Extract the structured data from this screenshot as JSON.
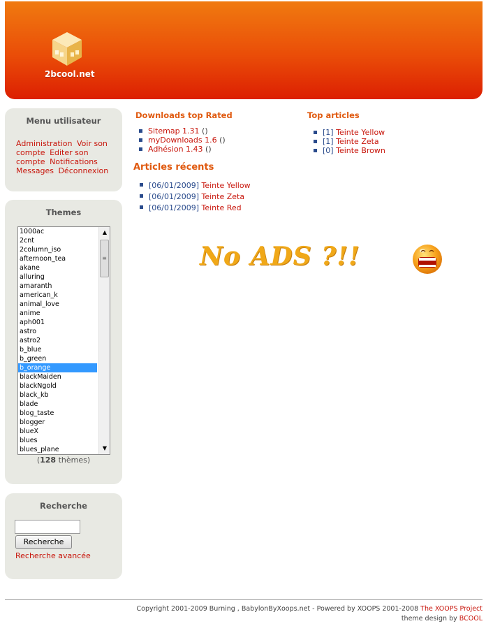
{
  "header": {
    "logo_text": "2bcool.net"
  },
  "user_menu": {
    "title": "Menu utilisateur",
    "links": [
      "Administration",
      "Voir son compte",
      "Editer son compte",
      "Notifications",
      "Messages",
      "Déconnexion"
    ]
  },
  "themes": {
    "title": "Themes",
    "items": [
      "1000ac",
      "2cnt",
      "2column_iso",
      "afternoon_tea",
      "akane",
      "alluring",
      "amaranth",
      "american_k",
      "animal_love",
      "anime",
      "aph001",
      "astro",
      "astro2",
      "b_blue",
      "b_green",
      "b_orange",
      "blackMaiden",
      "blackNgold",
      "black_kb",
      "blade",
      "blog_taste",
      "blogger",
      "blueX",
      "blues",
      "blues_plane"
    ],
    "selected": "b_orange",
    "count_open": "(",
    "count": "128",
    "count_label": "thèmes)"
  },
  "search": {
    "title": "Recherche",
    "input_value": "",
    "button_label": "Recherche",
    "advanced_label": "Recherche avancée"
  },
  "downloads": {
    "title": "Downloads top Rated",
    "items": [
      {
        "name": "Sitemap 1.31",
        "suffix": "()"
      },
      {
        "name": "myDownloads 1.6",
        "suffix": "()"
      },
      {
        "name": "Adhésion 1.43",
        "suffix": "()"
      }
    ]
  },
  "top_articles": {
    "title": "Top articles",
    "items": [
      {
        "count": "[1]",
        "name": "Teinte Yellow"
      },
      {
        "count": "[1]",
        "name": "Teinte Zeta"
      },
      {
        "count": "[0]",
        "name": "Teinte Brown"
      }
    ]
  },
  "recent_articles": {
    "title": "Articles récents",
    "items": [
      {
        "date": "[06/01/2009]",
        "name": "Teinte Yellow"
      },
      {
        "date": "[06/01/2009]",
        "name": "Teinte Zeta"
      },
      {
        "date": "[06/01/2009]",
        "name": "Teinte Red"
      }
    ]
  },
  "banner": {
    "text": "No ADS ?!!",
    "smiley_icon": "shocked-smiley-icon"
  },
  "footer": {
    "copyright": "Copyright 2001-2009 Burning , BabylonByXoops.net - Powered by XOOPS 2001-2008",
    "xoops_link": "The XOOPS Project",
    "design_prefix": "theme design by",
    "design_link": "BCOOL"
  },
  "colors": {
    "header_top": "#f07a10",
    "header_bottom": "#dc1f02",
    "link": "#c8160c",
    "title_orange": "#e05a10",
    "block_bg": "#e8e9e3"
  }
}
